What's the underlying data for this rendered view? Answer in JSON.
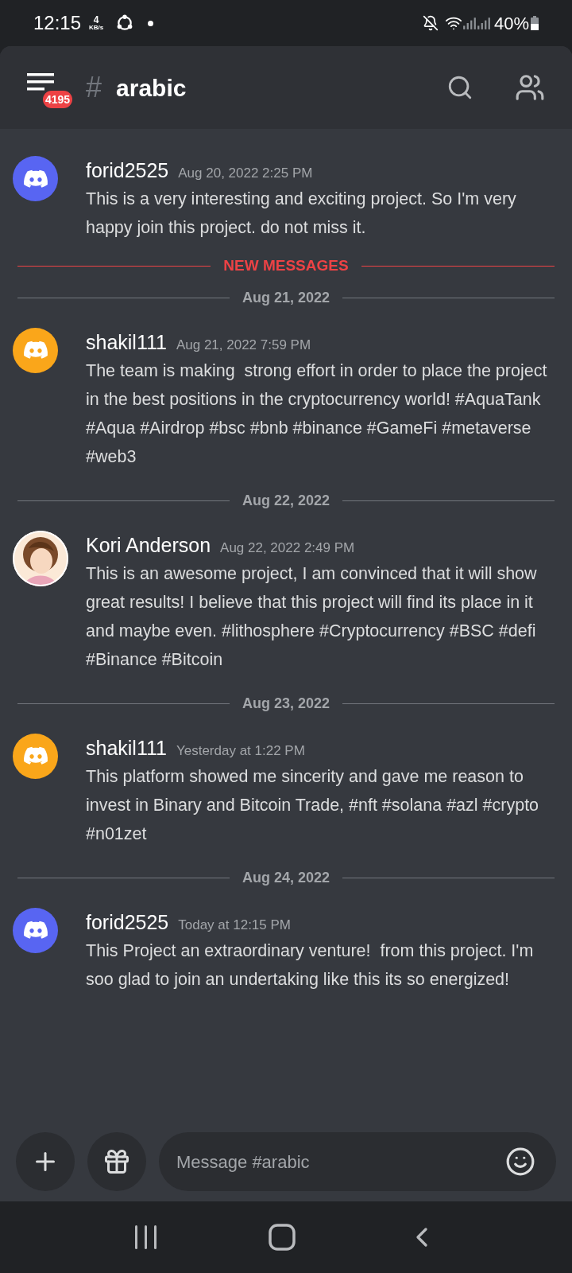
{
  "status_bar": {
    "time": "12:15",
    "speed_value": "4",
    "speed_unit": "KB/s",
    "battery": "40%"
  },
  "header": {
    "unread_badge": "4195",
    "hash": "#",
    "channel": "arabic"
  },
  "feed": [
    {
      "kind": "message",
      "avatar": {
        "kind": "discord",
        "color": "#5865f2"
      },
      "author": "forid2525",
      "time": "Aug 20, 2022 2:25 PM",
      "text": "This is a very interesting and exciting project. So I'm very happy join this project. do not miss it."
    },
    {
      "kind": "new",
      "label": "NEW MESSAGES"
    },
    {
      "kind": "date",
      "label": "Aug 21, 2022"
    },
    {
      "kind": "message",
      "avatar": {
        "kind": "discord",
        "color": "#faa61a"
      },
      "author": "shakil111",
      "time": "Aug 21, 2022 7:59 PM",
      "text": "The team is making  strong effort in order to place the project in the best positions in the cryptocurrency world! #AquaTank #Aqua #Airdrop #bsc #bnb #binance #GameFi #metaverse #web3"
    },
    {
      "kind": "date",
      "label": "Aug 22, 2022"
    },
    {
      "kind": "message",
      "author": "Kori Anderson",
      "time": "Aug 22, 2022 2:49 PM",
      "text": "This is an awesome project, I am convinced that it will show great results! I believe that this project will find its place in it and maybe even. #lithosphere #Cryptocurrency #BSC #defi #Binance #Bitcoin"
    },
    {
      "kind": "date",
      "label": "Aug 23, 2022"
    },
    {
      "kind": "message",
      "avatar": {
        "kind": "discord",
        "color": "#faa61a"
      },
      "author": "shakil111",
      "time": "Yesterday at 1:22 PM",
      "text": "This platform showed me sincerity and gave me reason to invest in Binary and Bitcoin Trade, #nft #solana #azl #crypto #n01zet"
    },
    {
      "kind": "date",
      "label": "Aug 24, 2022"
    },
    {
      "kind": "message",
      "avatar": {
        "kind": "discord",
        "color": "#5865f2"
      },
      "author": "forid2525",
      "time": "Today at 12:15 PM",
      "text": "This Project an extraordinary venture!  from this project. I'm soo glad to join an undertaking like this its so energized!"
    }
  ],
  "composer": {
    "placeholder": "Message #arabic"
  }
}
